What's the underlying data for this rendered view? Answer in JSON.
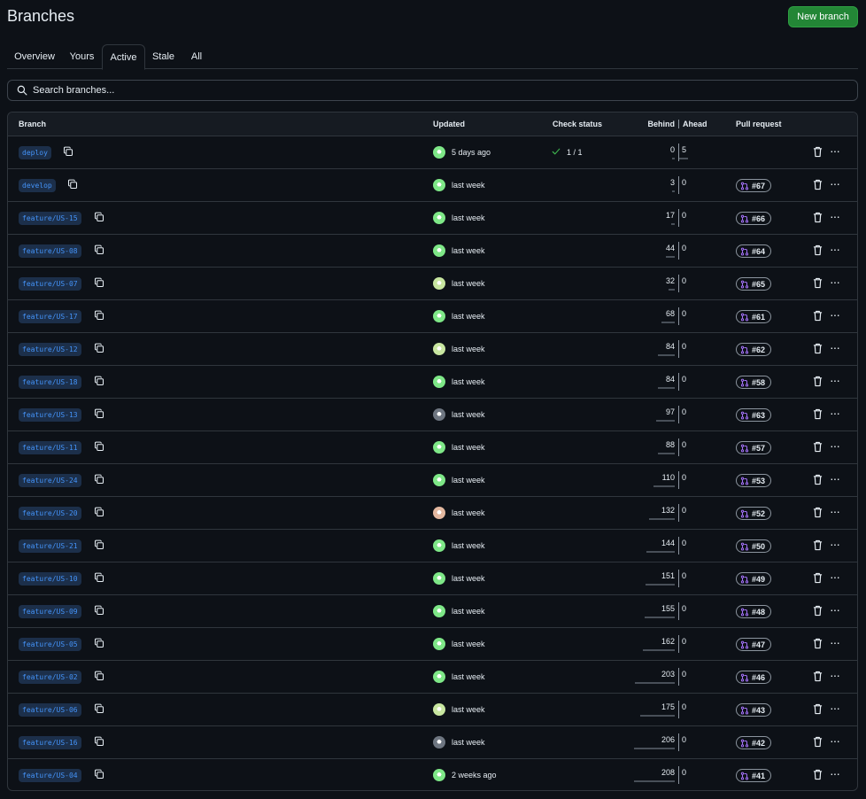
{
  "header": {
    "title": "Branches",
    "new_branch_label": "New branch"
  },
  "tabs": [
    {
      "label": "Overview"
    },
    {
      "label": "Yours"
    },
    {
      "label": "Active"
    },
    {
      "label": "Stale"
    },
    {
      "label": "All"
    }
  ],
  "search": {
    "placeholder": "Search branches..."
  },
  "table": {
    "headers": {
      "branch": "Branch",
      "updated": "Updated",
      "check_status": "Check status",
      "behind": "Behind",
      "ahead": "Ahead",
      "pull_request": "Pull request"
    },
    "rows": [
      {
        "name": "deploy",
        "updated": "5 days ago",
        "check": "1 / 1",
        "behind": "0",
        "ahead": "5",
        "pr": "",
        "avatar": "#7ee787"
      },
      {
        "name": "develop",
        "updated": "last week",
        "check": "",
        "behind": "3",
        "ahead": "0",
        "pr": "#67",
        "avatar": "#7ee787"
      },
      {
        "name": "feature/US-15",
        "updated": "last week",
        "check": "",
        "behind": "17",
        "ahead": "0",
        "pr": "#66",
        "avatar": "#7ee787"
      },
      {
        "name": "feature/US-08",
        "updated": "last week",
        "check": "",
        "behind": "44",
        "ahead": "0",
        "pr": "#64",
        "avatar": "#7ee787"
      },
      {
        "name": "feature/US-07",
        "updated": "last week",
        "check": "",
        "behind": "32",
        "ahead": "0",
        "pr": "#65",
        "avatar": "#c8e6a0"
      },
      {
        "name": "feature/US-17",
        "updated": "last week",
        "check": "",
        "behind": "68",
        "ahead": "0",
        "pr": "#61",
        "avatar": "#7ee787"
      },
      {
        "name": "feature/US-12",
        "updated": "last week",
        "check": "",
        "behind": "84",
        "ahead": "0",
        "pr": "#62",
        "avatar": "#c8e6a0"
      },
      {
        "name": "feature/US-18",
        "updated": "last week",
        "check": "",
        "behind": "84",
        "ahead": "0",
        "pr": "#58",
        "avatar": "#7ee787"
      },
      {
        "name": "feature/US-13",
        "updated": "last week",
        "check": "",
        "behind": "97",
        "ahead": "0",
        "pr": "#63",
        "avatar": "#6e7681"
      },
      {
        "name": "feature/US-11",
        "updated": "last week",
        "check": "",
        "behind": "88",
        "ahead": "0",
        "pr": "#57",
        "avatar": "#7ee787"
      },
      {
        "name": "feature/US-24",
        "updated": "last week",
        "check": "",
        "behind": "110",
        "ahead": "0",
        "pr": "#53",
        "avatar": "#7ee787"
      },
      {
        "name": "feature/US-20",
        "updated": "last week",
        "check": "",
        "behind": "132",
        "ahead": "0",
        "pr": "#52",
        "avatar": "#e3b8a0"
      },
      {
        "name": "feature/US-21",
        "updated": "last week",
        "check": "",
        "behind": "144",
        "ahead": "0",
        "pr": "#50",
        "avatar": "#7ee787"
      },
      {
        "name": "feature/US-10",
        "updated": "last week",
        "check": "",
        "behind": "151",
        "ahead": "0",
        "pr": "#49",
        "avatar": "#7ee787"
      },
      {
        "name": "feature/US-09",
        "updated": "last week",
        "check": "",
        "behind": "155",
        "ahead": "0",
        "pr": "#48",
        "avatar": "#7ee787"
      },
      {
        "name": "feature/US-05",
        "updated": "last week",
        "check": "",
        "behind": "162",
        "ahead": "0",
        "pr": "#47",
        "avatar": "#7ee787"
      },
      {
        "name": "feature/US-02",
        "updated": "last week",
        "check": "",
        "behind": "203",
        "ahead": "0",
        "pr": "#46",
        "avatar": "#7ee787"
      },
      {
        "name": "feature/US-06",
        "updated": "last week",
        "check": "",
        "behind": "175",
        "ahead": "0",
        "pr": "#43",
        "avatar": "#c8e6a0"
      },
      {
        "name": "feature/US-16",
        "updated": "last week",
        "check": "",
        "behind": "206",
        "ahead": "0",
        "pr": "#42",
        "avatar": "#6e7681"
      },
      {
        "name": "feature/US-04",
        "updated": "2 weeks ago",
        "check": "",
        "behind": "208",
        "ahead": "0",
        "pr": "#41",
        "avatar": "#7ee787"
      }
    ]
  },
  "colors": {
    "background": "#0d1117",
    "accent_green": "#238636",
    "branch_blue": "#4493f8",
    "border": "#30363d"
  },
  "icons": {
    "search": "search-icon",
    "copy": "copy-icon",
    "check": "check-icon",
    "pull_request": "git-pull-request-icon",
    "trash": "trash-icon",
    "more": "kebab-horizontal-icon"
  }
}
